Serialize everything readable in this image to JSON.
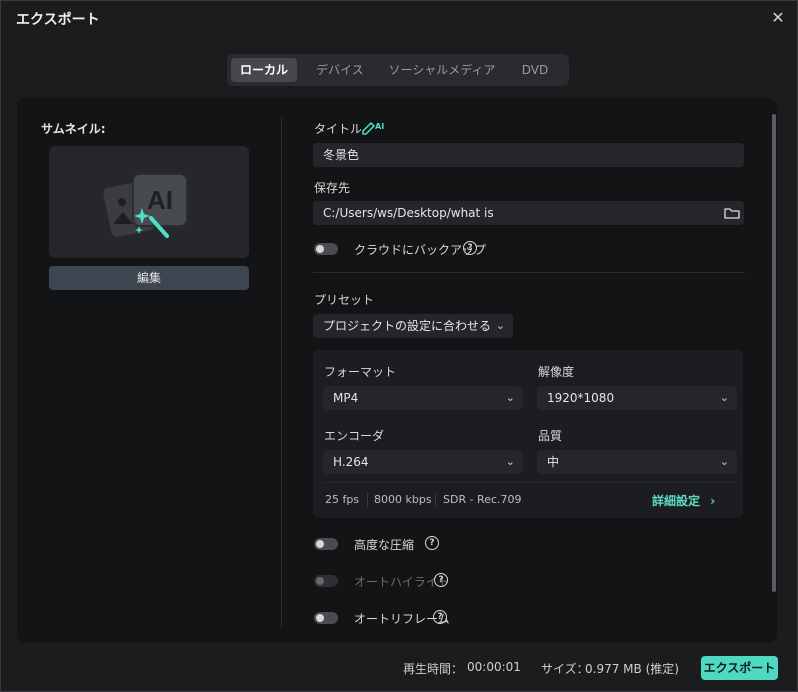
{
  "window": {
    "title": "エクスポート",
    "close_glyph": "✕"
  },
  "tabs": [
    {
      "label": "ローカル",
      "active": true
    },
    {
      "label": "デバイス",
      "active": false
    },
    {
      "label": "ソーシャルメディア",
      "active": false
    },
    {
      "label": "DVD",
      "active": false
    }
  ],
  "thumbnail": {
    "label": "サムネイル:",
    "edit_label": "編集",
    "icon": "ai-magic-image-icon"
  },
  "form": {
    "title_label": "タイトル",
    "title_ai_badge": "AI",
    "title_value": "冬景色",
    "dest_label": "保存先",
    "dest_value": "C:/Users/ws/Desktop/what is",
    "cloud_label": "クラウドにバックアップ",
    "preset_label": "プリセット",
    "preset_value": "プロジェクトの設定に合わせる",
    "format_label": "フォーマット",
    "format_value": "MP4",
    "resolution_label": "解像度",
    "resolution_value": "1920*1080",
    "encoder_label": "エンコーダ",
    "encoder_value": "H.264",
    "quality_label": "品質",
    "quality_value": "中",
    "fps": "25 fps",
    "bitrate": "8000 kbps",
    "color": "SDR - Rec.709",
    "advanced_label": "詳細設定",
    "advanced_chevron": "›",
    "compress_label": "高度な圧縮",
    "highlight_label": "オートハイライト",
    "reframe_label": "オートリフレーム",
    "help_glyph": "?"
  },
  "footer": {
    "duration_label": "再生時間：",
    "duration_value": "00:00:01",
    "size_label": "サイズ：",
    "size_value": "0.977 MB (推定)",
    "export_label": "エクスポート"
  },
  "colors": {
    "accent": "#4fd9c0",
    "background": "#1b1c1e",
    "panel": "#131416"
  }
}
